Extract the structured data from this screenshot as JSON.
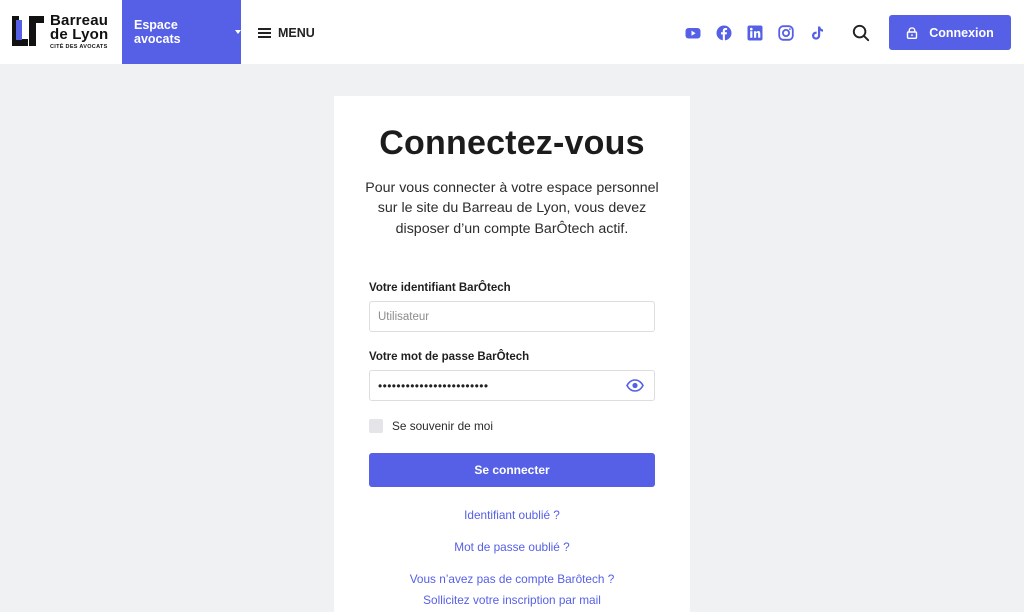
{
  "header": {
    "logo": {
      "line1": "Barreau",
      "line2": "de Lyon",
      "tagline": "CITÉ DES AVOCATS"
    },
    "espace_label": "Espace avocats",
    "menu_label": "MENU",
    "social_icons": [
      "youtube-icon",
      "facebook-icon",
      "linkedin-icon",
      "instagram-icon",
      "tiktok-icon"
    ],
    "connexion_label": "Connexion"
  },
  "login": {
    "title": "Connectez-vous",
    "intro": "Pour vous connecter à votre espace personnel sur le site du Barreau de Lyon, vous devez disposer d’un compte BarÔtech actif.",
    "username_label": "Votre identifiant BarÔtech",
    "username_placeholder": "Utilisateur",
    "username_value": "",
    "password_label": "Votre mot de passe BarÔtech",
    "password_value": "••••••••••••••••••••••••",
    "remember_label": "Se souvenir de moi",
    "remember_checked": false,
    "submit_label": "Se connecter",
    "forgot_id": "Identifiant oublié ?",
    "forgot_pwd": "Mot de passe oublié ?",
    "no_account": "Vous n’avez pas de compte Barôtech ?",
    "request_signup": "Sollicitez votre inscription par mail"
  },
  "colors": {
    "accent": "#5560e6",
    "page_bg": "#f0f1f3",
    "card_bg": "#ffffff"
  }
}
